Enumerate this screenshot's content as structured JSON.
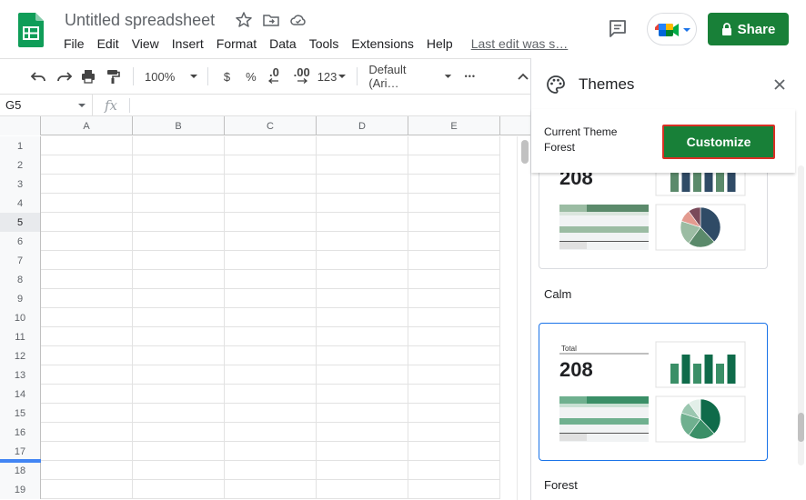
{
  "app": {
    "doc_title": "Untitled spreadsheet",
    "share_label": "Share",
    "menus": [
      "File",
      "Edit",
      "View",
      "Insert",
      "Format",
      "Data",
      "Tools",
      "Extensions",
      "Help"
    ],
    "last_edit": "Last edit was s…"
  },
  "toolbar": {
    "zoom": "100%",
    "currency": "$",
    "percent": "%",
    "dec_decrease": ".0",
    "dec_increase": ".00",
    "number_format": "123",
    "font": "Default (Ari…",
    "more": "•••"
  },
  "formula_bar": {
    "name_box": "G5",
    "fx": "fx",
    "value": ""
  },
  "grid": {
    "columns": [
      "A",
      "B",
      "C",
      "D",
      "E"
    ],
    "rows": [
      "1",
      "2",
      "3",
      "4",
      "5",
      "6",
      "7",
      "8",
      "9",
      "10",
      "11",
      "12",
      "13",
      "14",
      "15",
      "16",
      "17",
      "18",
      "19"
    ],
    "active_row": "5"
  },
  "panel": {
    "title": "Themes",
    "current_theme_label": "Current Theme",
    "current_theme_name": "Forest",
    "customize_label": "Customize",
    "themes": [
      {
        "name": "Calm",
        "total_label": "",
        "total_value": "208",
        "colors": {
          "dark": "#2f4b66",
          "mid": "#5b8a6b",
          "light": "#9bbca3",
          "pale": "#dbe6de",
          "accent": "#e39a8f",
          "accent2": "#7a4a5a"
        }
      },
      {
        "name": "Forest",
        "total_label": "Total",
        "total_value": "208",
        "colors": {
          "dark": "#0f6b4a",
          "mid": "#3a8f67",
          "light": "#6fb08f",
          "pale": "#c8e0d3",
          "accent": "#9bc7b0",
          "accent2": "#e2efe8"
        }
      }
    ]
  }
}
